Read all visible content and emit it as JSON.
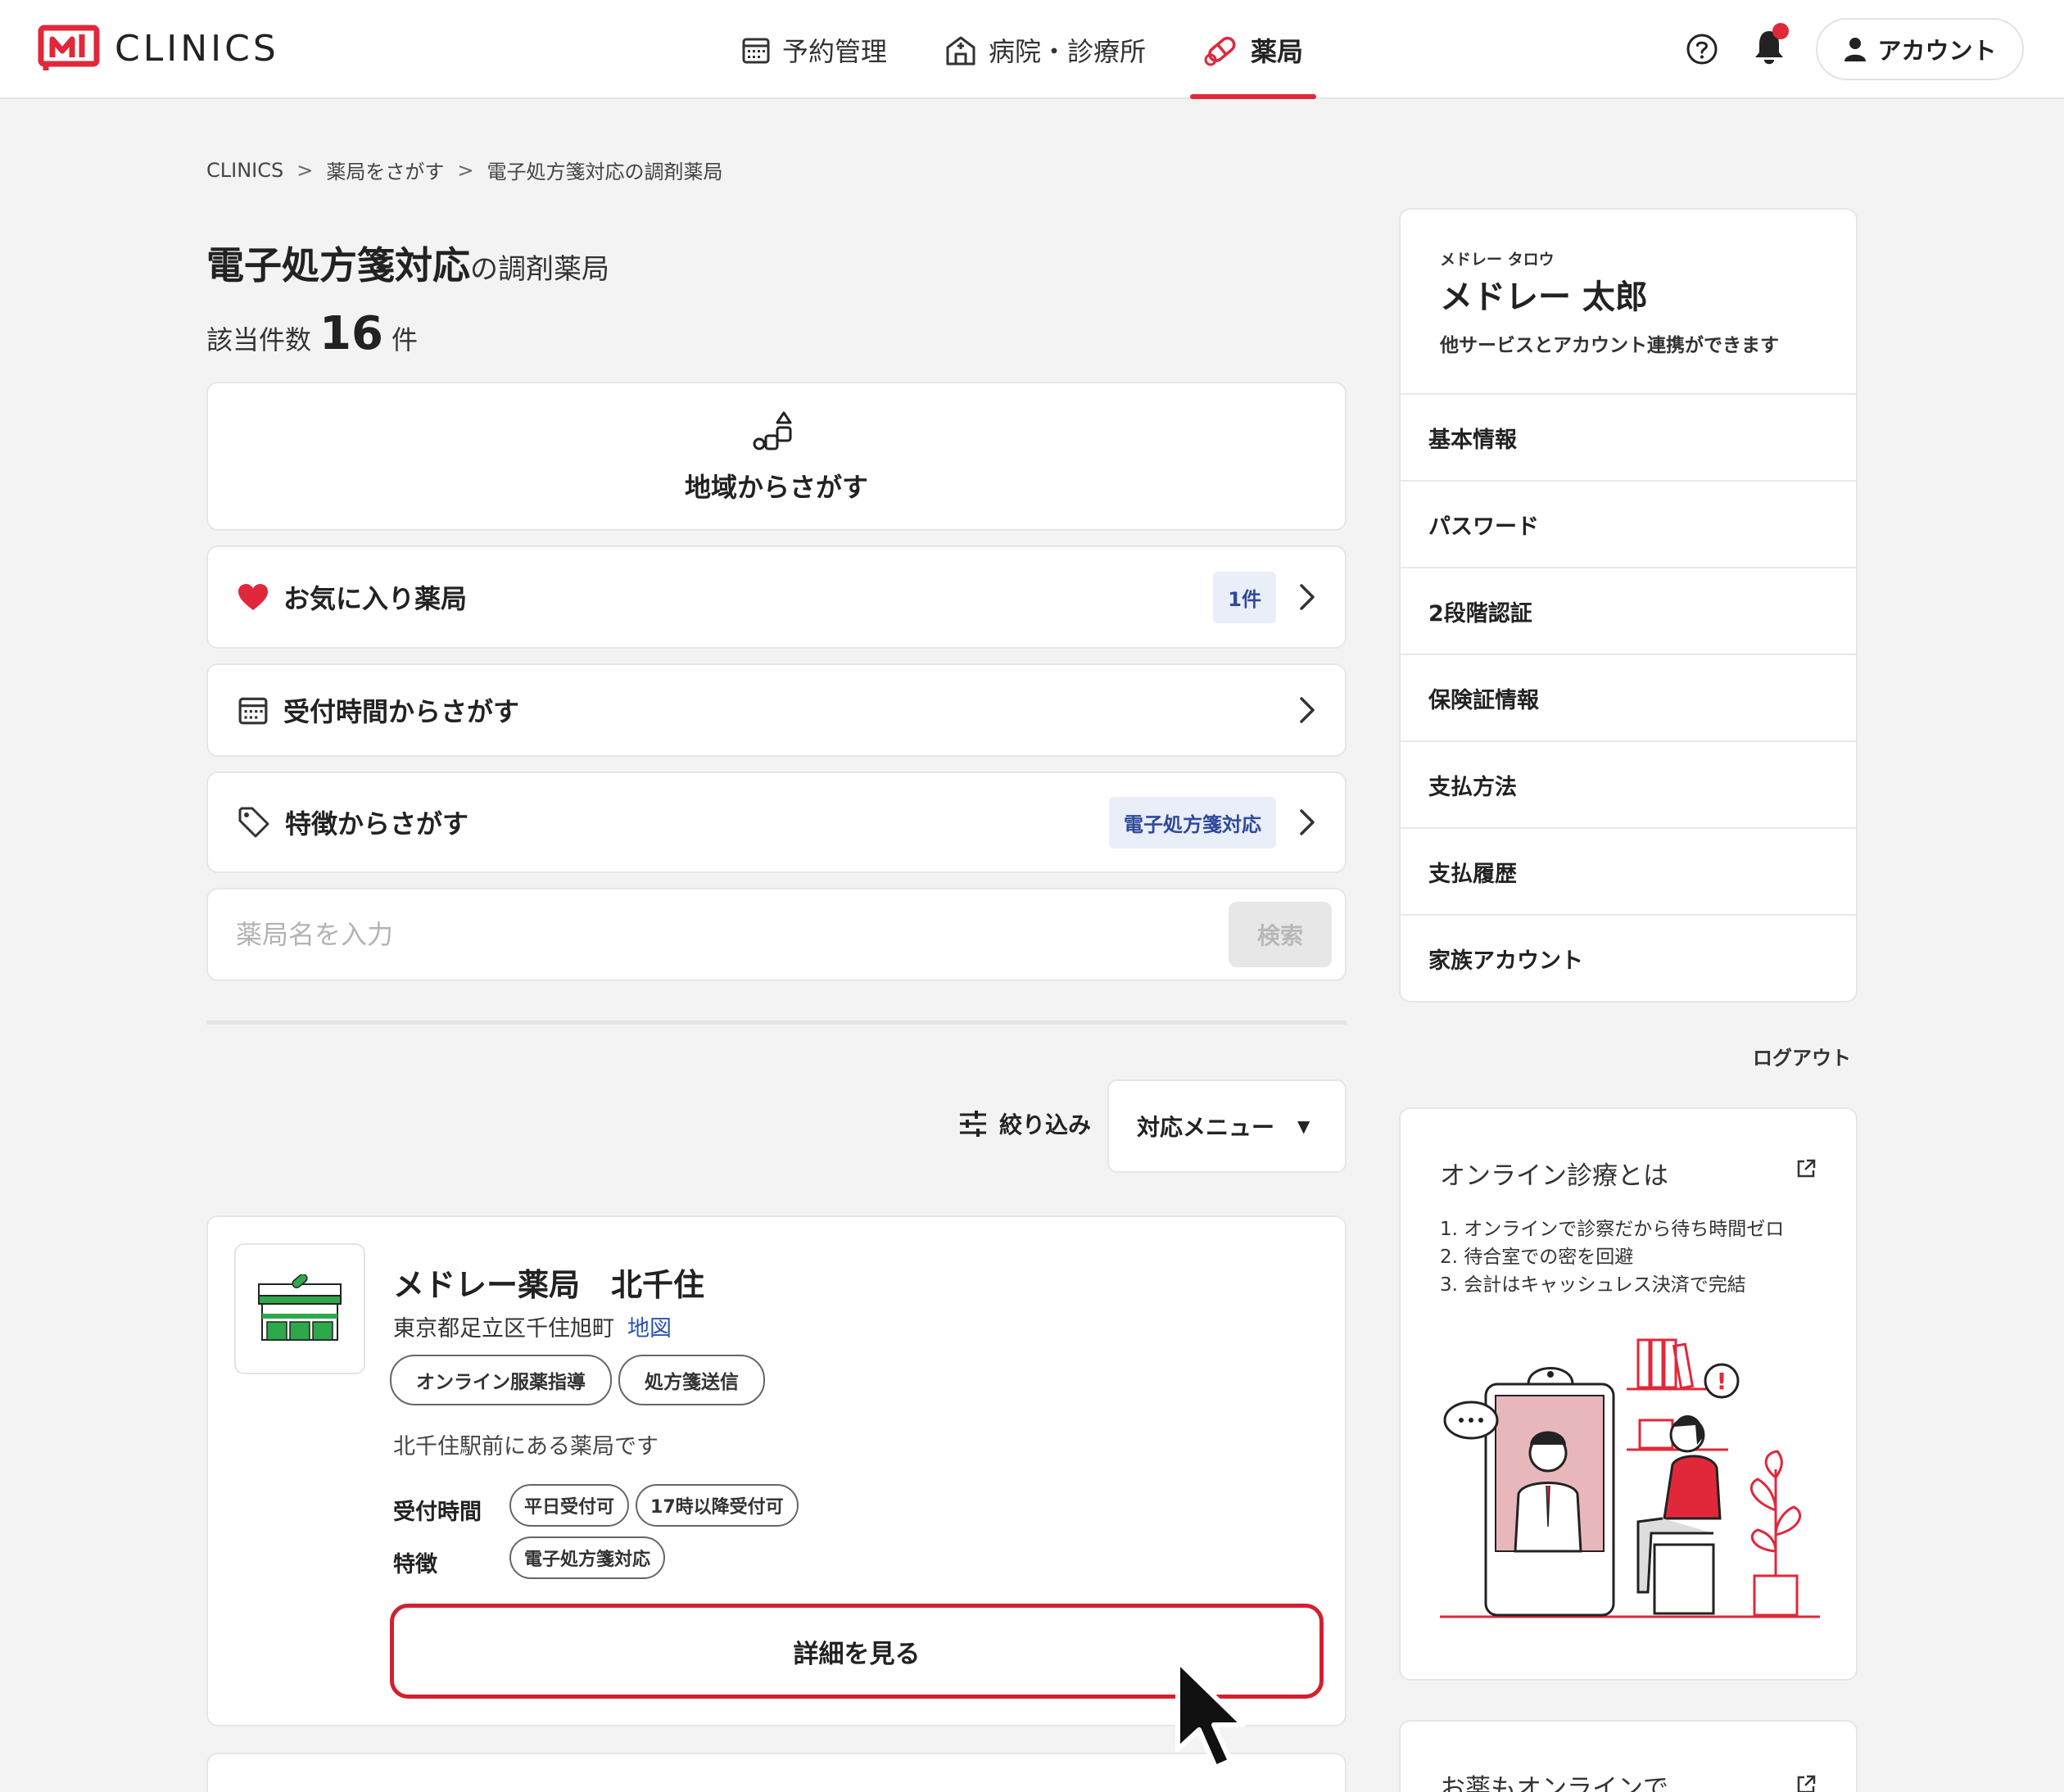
{
  "header": {
    "logo_text": "CLINICS",
    "nav": [
      {
        "label": "予約管理",
        "icon": "calendar-icon"
      },
      {
        "label": "病院・診療所",
        "icon": "hospital-icon"
      },
      {
        "label": "薬局",
        "icon": "pill-icon",
        "active": true
      }
    ],
    "account_label": "アカウント",
    "accent_color": "#e0283a"
  },
  "breadcrumb": [
    "CLINICS",
    "薬局をさがす",
    "電子処方箋対応の調剤薬局"
  ],
  "title": {
    "main": "電子処方箋対応",
    "suffix": "の調剤薬局"
  },
  "count": {
    "prefix": "該当件数",
    "value": "16",
    "suffix": "件"
  },
  "search_options": {
    "region": "地域からさがす",
    "favorites": {
      "label": "お気に入り薬局",
      "badge": "1件"
    },
    "time": {
      "label": "受付時間からさがす"
    },
    "features": {
      "label": "特徴からさがす",
      "badge": "電子処方箋対応"
    }
  },
  "search": {
    "placeholder": "薬局名を入力",
    "button": "検索"
  },
  "filter": {
    "label": "絞り込み",
    "menu_select": "対応メニュー"
  },
  "pharmacy": {
    "name": "メドレー薬局　北千住",
    "address": "東京都足立区千住旭町",
    "map_link": "地図",
    "service_tags": [
      "オンライン服薬指導",
      "処方箋送信"
    ],
    "description": "北千住駅前にある薬局です",
    "hours_label": "受付時間",
    "hours_tags": [
      "平日受付可",
      "17時以降受付可"
    ],
    "features_label": "特徴",
    "feature_tags": [
      "電子処方箋対応"
    ],
    "detail_button": "詳細を見る"
  },
  "account_panel": {
    "kana": "メドレー タロウ",
    "name": "メドレー 太郎",
    "subtitle": "他サービスとアカウント連携ができます",
    "menu": [
      "基本情報",
      "パスワード",
      "2段階認証",
      "保険証情報",
      "支払方法",
      "支払履歴",
      "家族アカウント"
    ],
    "logout": "ログアウト"
  },
  "info_card": {
    "title": "オンライン診療とは",
    "items": [
      "1. オンラインで診察だから待ち時間ゼロ",
      "2. 待合室での密を回避",
      "3. 会計はキャッシュレス決済で完結"
    ]
  },
  "info_card2": {
    "title": "お薬もオンラインで"
  }
}
